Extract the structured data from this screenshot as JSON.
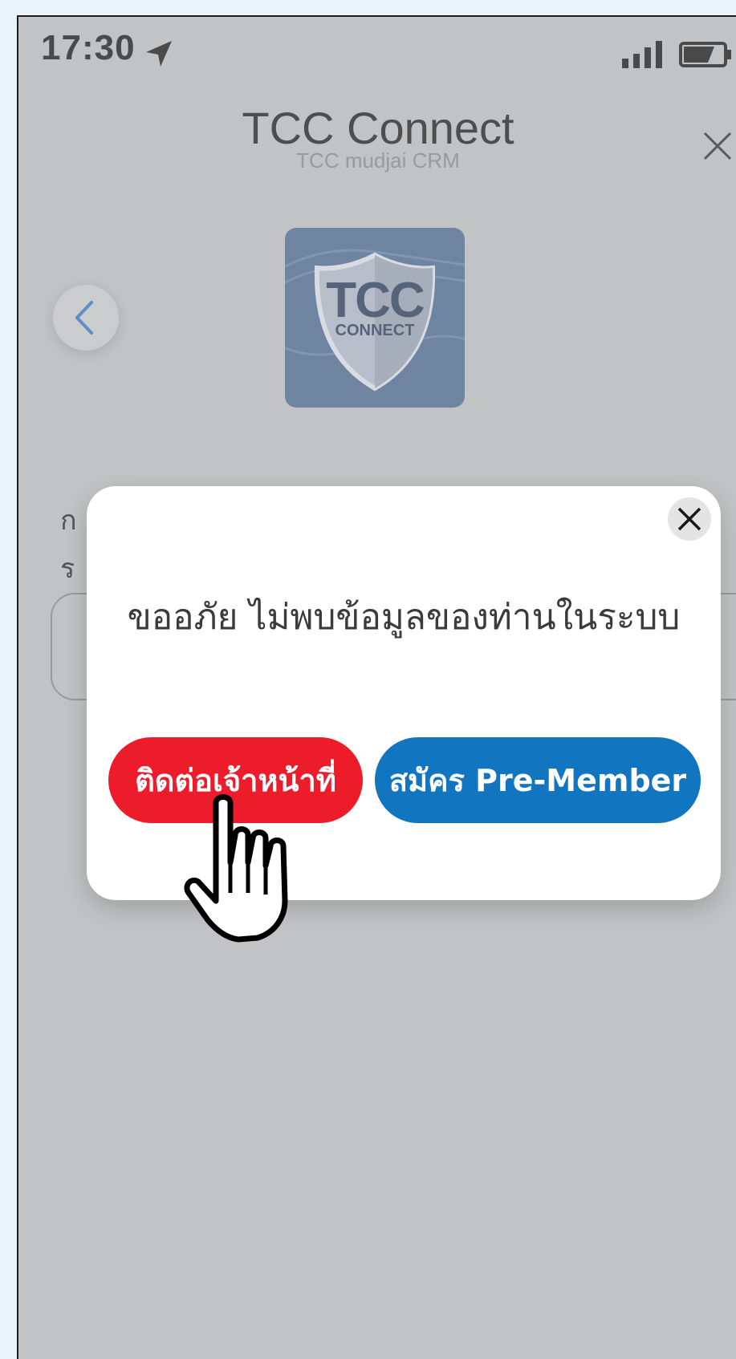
{
  "status_bar": {
    "time": "17:30",
    "icons": [
      "location-arrow-icon",
      "signal-icon",
      "battery-icon"
    ]
  },
  "header": {
    "title": "TCC Connect",
    "subtitle": "TCC mudjai CRM",
    "close_icon": "close-icon"
  },
  "logo": {
    "line1": "TCC",
    "line2": "CONNECT"
  },
  "background_form": {
    "label_1": "ก",
    "label_2": "ร"
  },
  "dialog": {
    "message": "ขออภัย ไม่พบข้อมูลของท่านในระบบ",
    "contact_button": "ติดต่อเจ้าหน้าที่",
    "register_button": "สมัคร Pre-Member",
    "close_icon": "close-icon"
  },
  "colors": {
    "overlay_bg": "#c2c3c5",
    "contact_red": "#ec1c2a",
    "register_blue": "#1175bf",
    "back_arrow": "#5b8fc4"
  }
}
